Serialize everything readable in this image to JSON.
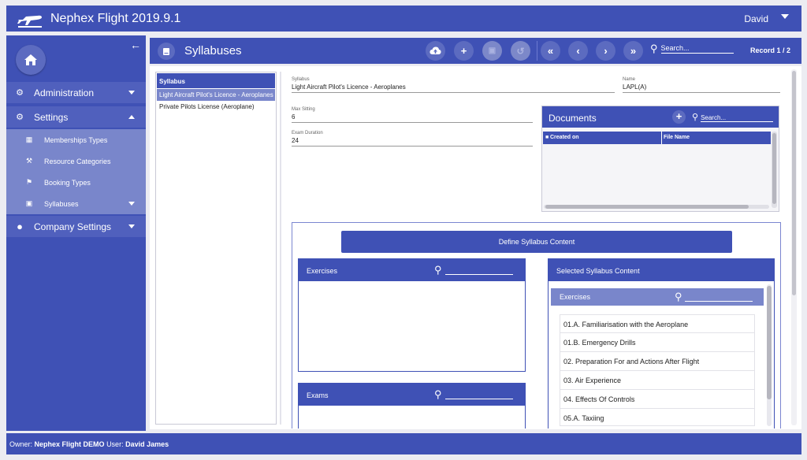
{
  "app": {
    "title": "Nephex Flight 2019.9.1",
    "user": "David"
  },
  "sidebar": {
    "items": [
      {
        "label": "Administration",
        "icon": "gear-icon"
      },
      {
        "label": "Settings",
        "icon": "gears-icon"
      },
      {
        "label": "Memberships Types",
        "icon": "calendar-icon"
      },
      {
        "label": "Resource Categories",
        "icon": "wrench-icon"
      },
      {
        "label": "Booking Types",
        "icon": "tags-icon"
      },
      {
        "label": "Syllabuses",
        "icon": "book-icon"
      },
      {
        "label": "Company Settings",
        "icon": "users-icon"
      }
    ]
  },
  "header": {
    "title": "Syllabuses",
    "search_placeholder": "Search...",
    "record": "Record 1 / 2"
  },
  "list": {
    "header": "Syllabus",
    "items": [
      "Light Aircraft Pilot's Licence - Aeroplanes",
      "Private Pilots License (Aeroplane)"
    ]
  },
  "form": {
    "syllabus_label": "Syllabus",
    "syllabus_value": "Light Aircraft Pilot's Licence - Aeroplanes",
    "name_label": "Name",
    "name_value": "LAPL(A)",
    "max_sitting_label": "Max Sitting",
    "max_sitting_value": "6",
    "exam_duration_label": "Exam Duration",
    "exam_duration_value": "24"
  },
  "documents": {
    "title": "Documents",
    "search_placeholder": "Search...",
    "columns": [
      "Created on",
      "File Name"
    ]
  },
  "content": {
    "define_button": "Define Syllabus Content",
    "exercises_title": "Exercises",
    "exams_title": "Exams",
    "selected_title": "Selected Syllabus Content",
    "selected_exercises_title": "Exercises",
    "selected_items": [
      "01.A. Familiarisation with the Aeroplane",
      "01.B. Emergency Drills",
      "02. Preparation For and Actions After Flight",
      "03. Air Experience",
      "04. Effects Of Controls",
      "05.A. Taxiing"
    ]
  },
  "footer": {
    "owner_label": "Owner:",
    "owner": "Nephex Flight DEMO",
    "user_label": "User:",
    "user": "David James"
  }
}
